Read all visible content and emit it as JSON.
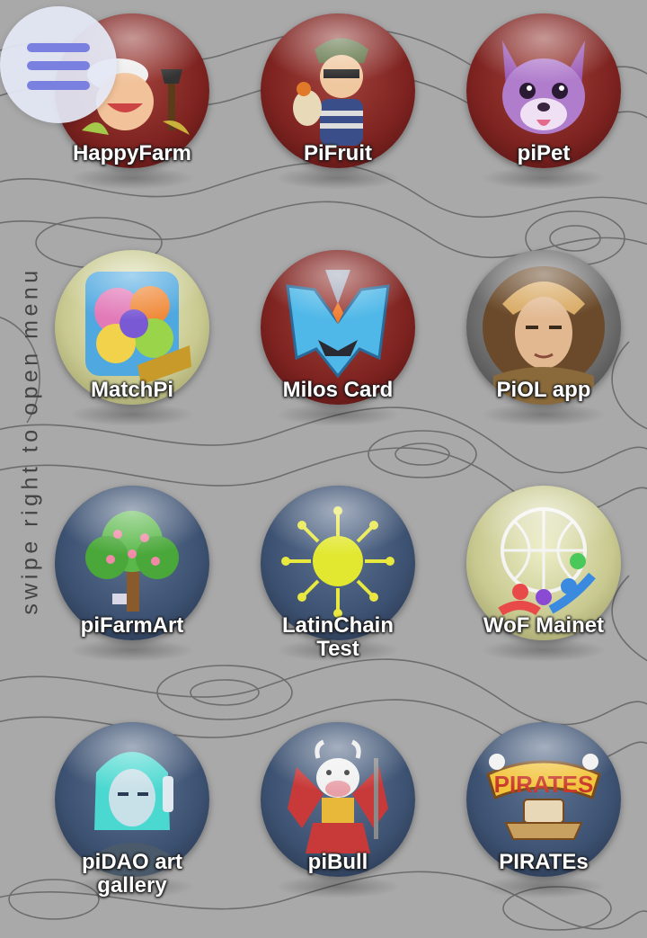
{
  "menu": {
    "icon": "hamburger-menu-icon"
  },
  "side_hint": "swipe right to open menu",
  "apps": [
    {
      "label": "HappyFarm",
      "icon": "happyfarm-farmer-icon",
      "theme": "red"
    },
    {
      "label": "PiFruit",
      "icon": "pifruit-character-icon",
      "theme": "red"
    },
    {
      "label": "piPet",
      "icon": "pipet-dog-icon",
      "theme": "red"
    },
    {
      "label": "MatchPi",
      "icon": "matchpi-candy-icon",
      "theme": "olive"
    },
    {
      "label": "Milos Card",
      "icon": "milos-card-logo-icon",
      "theme": "red"
    },
    {
      "label": "PiOL app",
      "icon": "piol-warrior-icon",
      "theme": "grey"
    },
    {
      "label": "piFarmArt",
      "icon": "pifarmart-tree-icon",
      "theme": "navy"
    },
    {
      "label": "LatinChain\nTest",
      "icon": "latinchain-sun-icon",
      "theme": "navy"
    },
    {
      "label": "WoF Mainet",
      "icon": "wof-globe-people-icon",
      "theme": "olive"
    },
    {
      "label": "piDAO art\ngallery",
      "icon": "pidao-cyber-girl-icon",
      "theme": "navy"
    },
    {
      "label": "piBull",
      "icon": "pibull-devil-bull-icon",
      "theme": "navy"
    },
    {
      "label": "PIRATEs",
      "icon": "pirates-logo-icon",
      "theme": "navy"
    }
  ]
}
